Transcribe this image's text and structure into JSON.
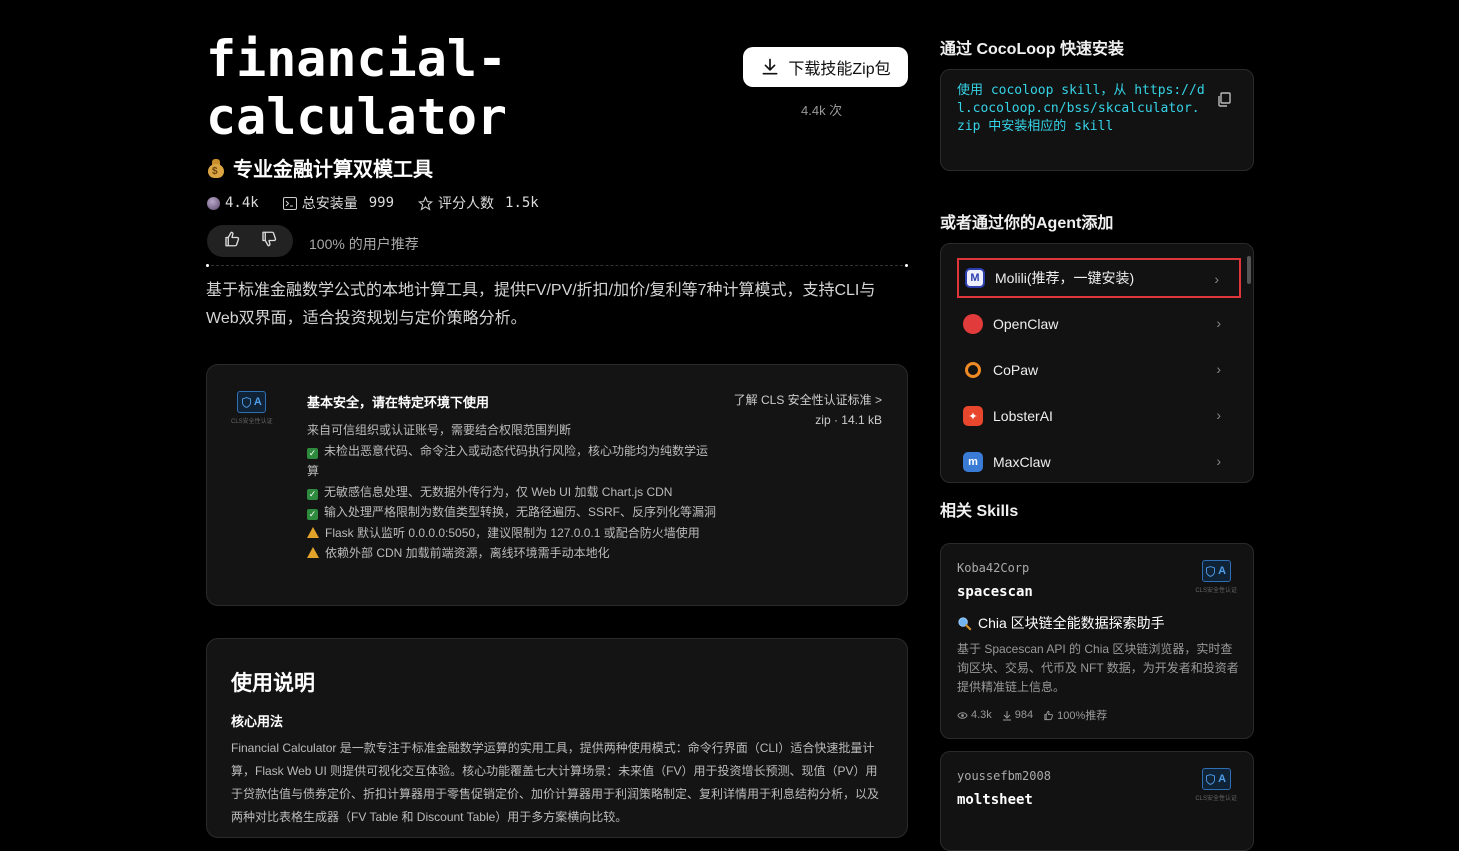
{
  "skill": {
    "title": "financial-calculator",
    "subtitle": "专业金融计算双模工具",
    "stats": {
      "views": "4.4k",
      "installs_label": "总安装量",
      "installs": "999",
      "ratings_label": "评分人数",
      "ratings": "1.5k"
    },
    "recommend_text": "100% 的用户推荐",
    "description": "基于标准金融数学公式的本地计算工具，提供FV/PV/折扣/加价/复利等7种计算模式，支持CLI与Web双界面，适合投资规划与定价策略分析。",
    "download": {
      "label": "下载技能Zip包",
      "count": "4.4k 次"
    }
  },
  "security": {
    "badge": "A",
    "badge_caption": "CLS安全性认证",
    "title": "基本安全，请在特定环境下使用",
    "link": "了解 CLS 安全性认证标准 >",
    "meta": "zip · 14.1 kB",
    "lines": [
      {
        "type": "text",
        "text": "来自可信组织或认证账号，需要结合权限范围判断"
      },
      {
        "type": "ok",
        "text": "未检出恶意代码、命令注入或动态代码执行风险，核心功能均为纯数学运算"
      },
      {
        "type": "ok",
        "text": "无敏感信息处理、无数据外传行为，仅 Web UI 加载 Chart.js CDN"
      },
      {
        "type": "ok",
        "text": "输入处理严格限制为数值类型转换，无路径遍历、SSRF、反序列化等漏洞"
      },
      {
        "type": "warn",
        "text": "Flask 默认监听 0.0.0.0:5050，建议限制为 127.0.0.1 或配合防火墙使用"
      },
      {
        "type": "warn",
        "text": "依赖外部 CDN 加载前端资源，离线环境需手动本地化"
      }
    ]
  },
  "usage": {
    "title": "使用说明",
    "subtitle": "核心用法",
    "text": "Financial Calculator 是一款专注于标准金融数学运算的实用工具，提供两种使用模式：命令行界面（CLI）适合快速批量计算，Flask Web UI 则提供可视化交互体验。核心功能覆盖七大计算场景：未来值（FV）用于投资增长预测、现值（PV）用于贷款估值与债券定价、折扣计算器用于零售促销定价、加价计算器用于利润策略制定、复利详情用于利息结构分析，以及两种对比表格生成器（FV Table 和 Discount Table）用于多方案横向比较。"
  },
  "sidebar": {
    "install_heading": "通过 CocoLoop 快速安装",
    "install_code": "使用 cocoloop skill，从 https://dl.cocoloop.cn/bss/skcalculator.zip 中安装相应的 skill",
    "agent_heading": "或者通过你的Agent添加",
    "agents": [
      {
        "name": "Molili(推荐，一键安装)",
        "icon": "molili-icon",
        "color": "#2d3fae"
      },
      {
        "name": "OpenClaw",
        "icon": "openclaw-icon",
        "color": "#e23b3b"
      },
      {
        "name": "CoPaw",
        "icon": "copaw-icon",
        "color": "#f08a24"
      },
      {
        "name": "LobsterAI",
        "icon": "lobsterai-icon",
        "color": "#e8462d"
      },
      {
        "name": "MaxClaw",
        "icon": "maxclaw-icon",
        "color": "#3a7bd5"
      }
    ],
    "related_heading": "相关 Skills",
    "related": [
      {
        "author": "Koba42Corp",
        "name": "spacescan",
        "badge": "A",
        "badge_caption": "CLS安全性认证",
        "tagline": "Chia 区块链全能数据探索助手",
        "desc": "基于 Spacescan API 的 Chia 区块链浏览器，实时查询区块、交易、代币及 NFT 数据，为开发者和投资者提供精准链上信息。",
        "views": "4.3k",
        "downloads": "984",
        "recommend": "100%推荐"
      },
      {
        "author": "youssefbm2008",
        "name": "moltsheet",
        "badge": "A",
        "badge_caption": "CLS安全性认证"
      }
    ]
  }
}
